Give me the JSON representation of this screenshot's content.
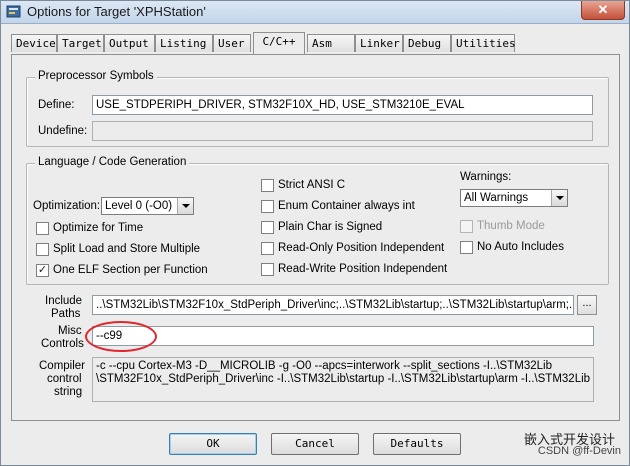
{
  "window": {
    "title": "Options for Target 'XPHStation'",
    "close_glyph": "✕"
  },
  "tabs": [
    {
      "label": "Device"
    },
    {
      "label": "Target"
    },
    {
      "label": "Output"
    },
    {
      "label": "Listing"
    },
    {
      "label": "User"
    },
    {
      "label": "C/C++",
      "active": true
    },
    {
      "label": "Asm"
    },
    {
      "label": "Linker"
    },
    {
      "label": "Debug"
    },
    {
      "label": "Utilities"
    }
  ],
  "preprocessor": {
    "title": "Preprocessor Symbols",
    "define_label": "Define:",
    "define_value": "USE_STDPERIPH_DRIVER, STM32F10X_HD, USE_STM3210E_EVAL",
    "undefine_label": "Undefine:",
    "undefine_value": ""
  },
  "language": {
    "title": "Language / Code Generation",
    "optimization_label": "Optimization:",
    "optimization_value": "Level 0 (-O0)",
    "warnings_label": "Warnings:",
    "warnings_value": "All Warnings",
    "checkboxes": {
      "optimize_time": {
        "label": "Optimize for Time",
        "checked": false
      },
      "split_load": {
        "label": "Split Load and Store Multiple",
        "checked": false
      },
      "one_elf": {
        "label": "One ELF Section per Function",
        "checked": true
      },
      "strict_ansi": {
        "label": "Strict ANSI C",
        "checked": false
      },
      "enum_container": {
        "label": "Enum Container always int",
        "checked": false
      },
      "plain_char": {
        "label": "Plain Char is Signed",
        "checked": false
      },
      "ro_pi": {
        "label": "Read-Only Position Independent",
        "checked": false
      },
      "rw_pi": {
        "label": "Read-Write Position Independent",
        "checked": false
      },
      "thumb_mode": {
        "label": "Thumb Mode",
        "checked": false,
        "disabled": true
      },
      "no_auto_includes": {
        "label": "No Auto Includes",
        "checked": false
      }
    },
    "check_glyph": "✓"
  },
  "include": {
    "label_line1": "Include",
    "label_line2": "Paths",
    "value": "..\\STM32Lib\\STM32F10x_StdPeriph_Driver\\inc;..\\STM32Lib\\startup;..\\STM32Lib\\startup\\arm;..\\ST",
    "browse_label": "..."
  },
  "misc": {
    "label_line1": "Misc",
    "label_line2": "Controls",
    "value": "--c99"
  },
  "compiler": {
    "label_line1": "Compiler",
    "label_line2": "control",
    "label_line3": "string",
    "value": "-c --cpu Cortex-M3 -D__MICROLIB -g -O0 --apcs=interwork --split_sections -I..\\STM32Lib \\STM32F10x_StdPeriph_Driver\\inc -I..\\STM32Lib\\startup -I..\\STM32Lib\\startup\\arm -I..\\STM32Lib"
  },
  "buttons": {
    "ok": "OK",
    "cancel": "Cancel",
    "defaults": "Defaults"
  },
  "watermark": {
    "line1": "嵌入式开发设计",
    "line2": "CSDN @ff-Devin"
  },
  "colors": {
    "callout": "#e2262e",
    "title_bar": "#c3d5ea",
    "dialog_bg": "#ececec"
  }
}
